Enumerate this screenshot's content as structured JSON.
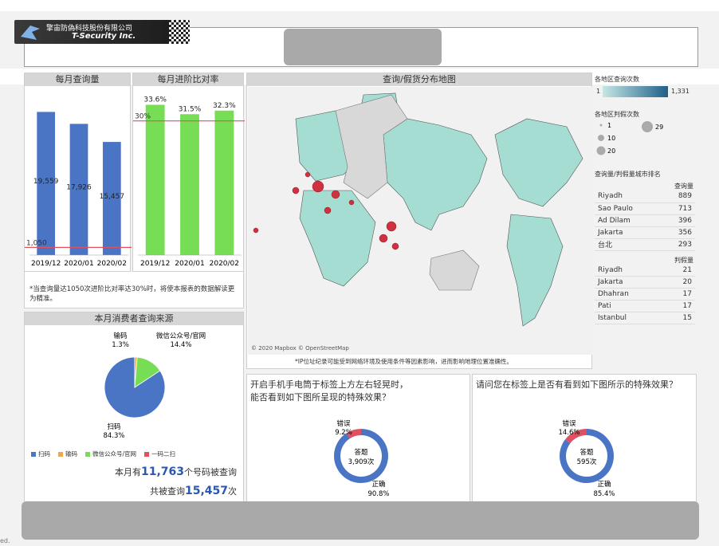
{
  "header": {
    "company_cn": "擎宙防偽科技股份有限公司",
    "company_en": "T-Security Inc."
  },
  "monthly_query": {
    "title": "每月查询量",
    "chart_data": {
      "type": "bar",
      "categories": [
        "2019/12",
        "2020/01",
        "2020/02"
      ],
      "values": [
        19559,
        17926,
        15457
      ],
      "value_labels": [
        "19,559",
        "17,926",
        "15,457"
      ],
      "threshold": 1050,
      "threshold_label": "1,050",
      "ylim": [
        0,
        22000
      ],
      "color": "#4a74c4",
      "threshold_color": "#e05060"
    },
    "note": "*当查询量达1050次进阶比对率达30%时，将使本报表的数据解读更为精准。"
  },
  "monthly_ratio": {
    "title": "每月进阶比对率",
    "chart_data": {
      "type": "bar",
      "categories": [
        "2019/12",
        "2020/01",
        "2020/02"
      ],
      "values": [
        33.6,
        31.5,
        32.3
      ],
      "value_labels": [
        "33.6%",
        "31.5%",
        "32.3%"
      ],
      "threshold": 30,
      "threshold_label": "30%",
      "ylim": [
        0,
        36
      ],
      "color": "#77dd55",
      "threshold_color": "#e05060"
    }
  },
  "map": {
    "title": "查询/假货分布地图",
    "attribution": "© 2020 Mapbox © OpenStreetMap",
    "note": "*IP位址纪录可能受到网络环境及使用条件等因素影响，进而影响地理位置准确性。",
    "legend_query_title": "各地区查询次数",
    "legend_query_min": "1",
    "legend_query_max": "1,331",
    "legend_fake_title": "各地区判假次数",
    "legend_fake_items": [
      "1",
      "10",
      "20",
      "29"
    ],
    "rank_title": "查询量/判假量城市排名",
    "query_header": "查询量",
    "query_rank": [
      {
        "city": "Riyadh",
        "value": "889"
      },
      {
        "city": "Sao Paulo",
        "value": "713"
      },
      {
        "city": "Ad Dilam",
        "value": "396"
      },
      {
        "city": "Jakarta",
        "value": "356"
      },
      {
        "city": "台北",
        "value": "293"
      }
    ],
    "fake_header": "判假量",
    "fake_rank": [
      {
        "city": "Riyadh",
        "value": "21"
      },
      {
        "city": "Jakarta",
        "value": "20"
      },
      {
        "city": "Dhahran",
        "value": "17"
      },
      {
        "city": "Pati",
        "value": "17"
      },
      {
        "city": "Istanbul",
        "value": "15"
      }
    ]
  },
  "source": {
    "title": "本月消费者查询来源",
    "chart_data": {
      "type": "pie",
      "slices": [
        {
          "name": "扫码",
          "value": 84.3,
          "label": "84.3%",
          "color": "#4a74c4"
        },
        {
          "name": "输码",
          "value": 1.3,
          "label": "1.3%",
          "color": "#f0a848"
        },
        {
          "name": "微信公众号/官网",
          "value": 14.4,
          "label": "14.4%",
          "color": "#77dd55"
        },
        {
          "name": "一码二扫",
          "value": 0.0,
          "label": "",
          "color": "#e05060"
        }
      ]
    },
    "summary1_pre": "本月有",
    "summary1_num": "11,763",
    "summary1_post": "个号码被查询",
    "summary2_pre": "共被查询",
    "summary2_num": "15,457",
    "summary2_post": "次"
  },
  "q1": {
    "title_line1": "开启手机手电筒于标签上方左右轻晃时，",
    "title_line2": "能否看到如下图所呈现的特殊效果？",
    "chart_data": {
      "type": "pie",
      "slices": [
        {
          "name": "错误",
          "value": 9.2,
          "label": "9.2%",
          "color": "#e05060"
        },
        {
          "name": "正确",
          "value": 90.8,
          "label": "90.8%",
          "color": "#4a74c4"
        }
      ]
    },
    "center_label": "答题",
    "center_value": "3,909次"
  },
  "q2": {
    "title": "请问您在标签上是否有看到如下图所示的特殊效果？",
    "chart_data": {
      "type": "pie",
      "slices": [
        {
          "name": "错误",
          "value": 14.6,
          "label": "14.6%",
          "color": "#e05060"
        },
        {
          "name": "正确",
          "value": 85.4,
          "label": "85.4%",
          "color": "#4a74c4"
        }
      ]
    },
    "center_label": "答题",
    "center_value": "595次"
  },
  "footer_fragment": "ed."
}
